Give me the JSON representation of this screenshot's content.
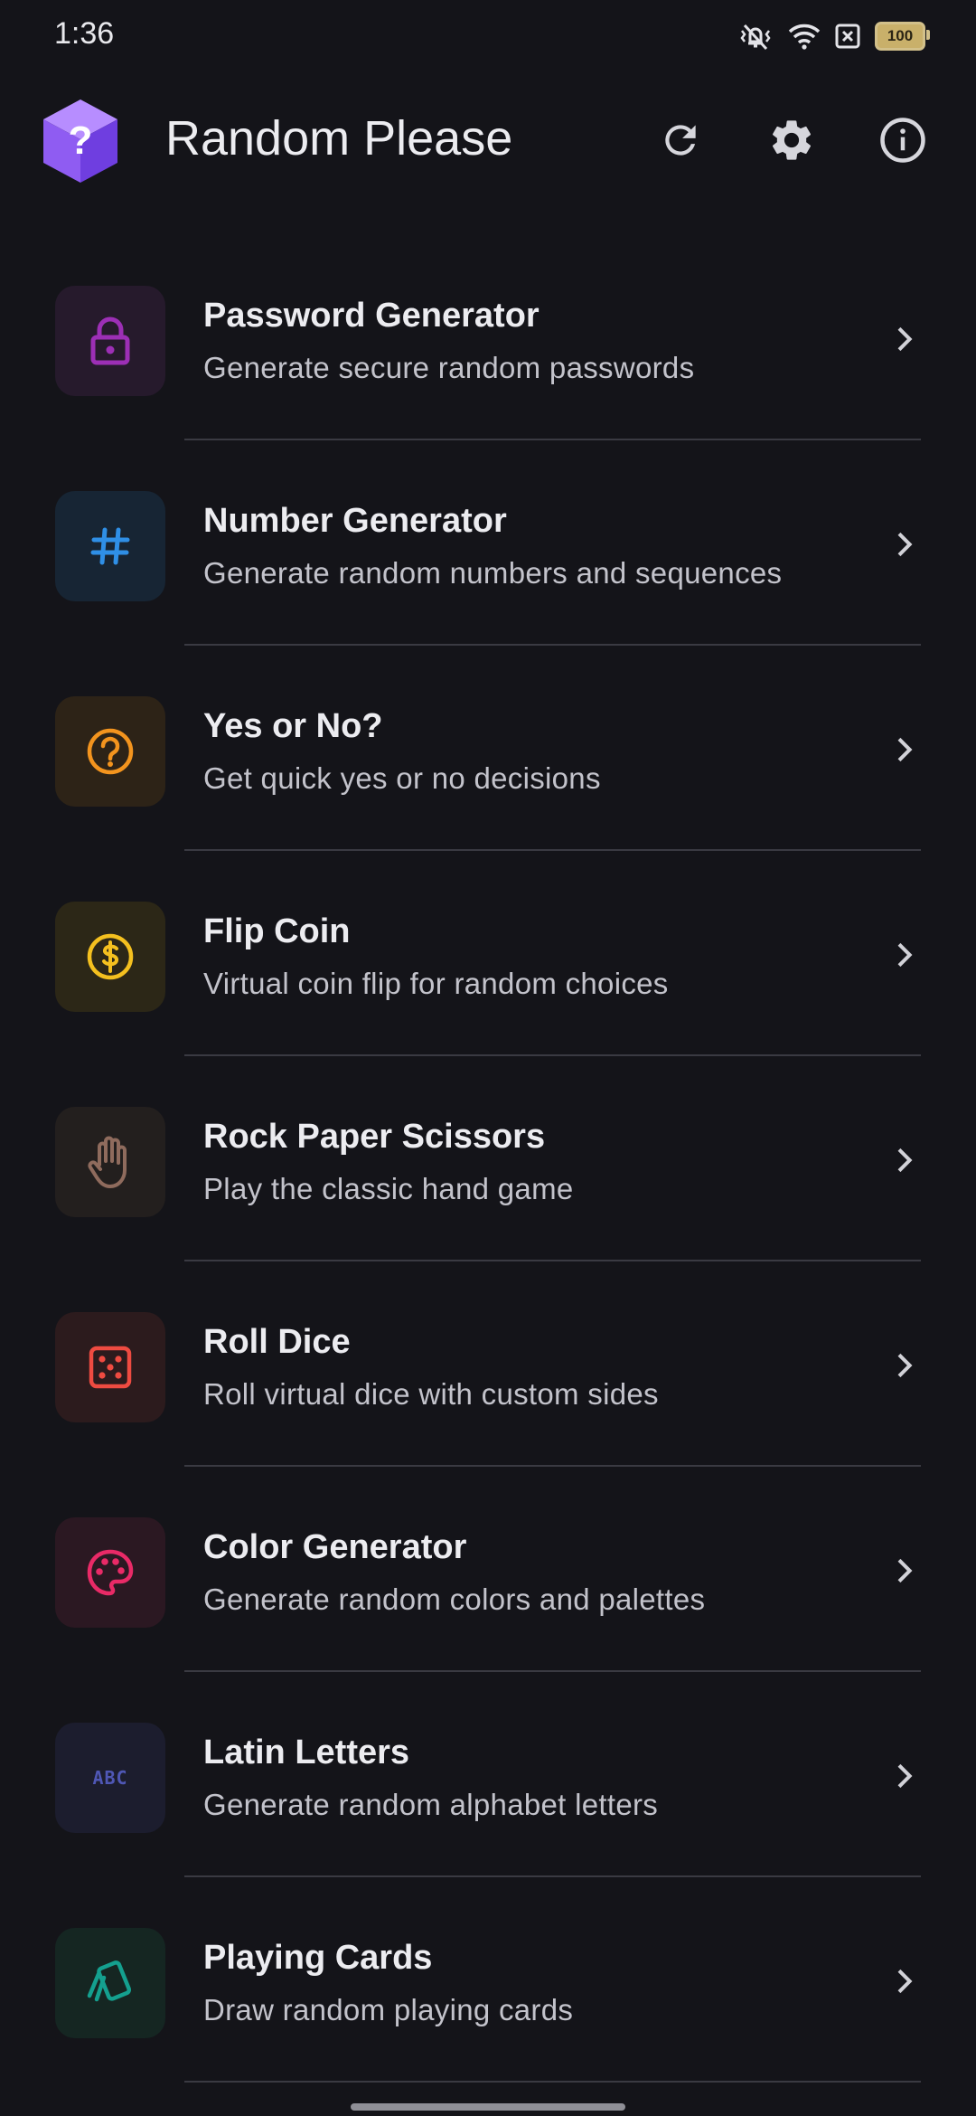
{
  "status_bar": {
    "time": "1:36",
    "battery": "100"
  },
  "app_bar": {
    "title": "Random Please",
    "logo_glyph": "?"
  },
  "items": [
    {
      "title": "Password Generator",
      "subtitle": "Generate secure random passwords",
      "icon": "lock-icon",
      "color": "#9c2fb5",
      "bg": "#261a2c"
    },
    {
      "title": "Number Generator",
      "subtitle": "Generate random numbers and sequences",
      "icon": "hash-icon",
      "color": "#2f8fe6",
      "bg": "#172534"
    },
    {
      "title": "Yes or No?",
      "subtitle": "Get quick yes or no decisions",
      "icon": "question-circle-icon",
      "color": "#f3941e",
      "bg": "#2d2317"
    },
    {
      "title": "Flip Coin",
      "subtitle": "Virtual coin flip for random choices",
      "icon": "coin-icon",
      "color": "#f4c01f",
      "bg": "#2c2717"
    },
    {
      "title": "Rock Paper Scissors",
      "subtitle": "Play the classic hand game",
      "icon": "hand-icon",
      "color": "#8f6b5d",
      "bg": "#231f1e"
    },
    {
      "title": "Roll Dice",
      "subtitle": "Roll virtual dice with custom sides",
      "icon": "dice-icon",
      "color": "#ee4b41",
      "bg": "#2c1b1d"
    },
    {
      "title": "Color Generator",
      "subtitle": "Generate random colors and palettes",
      "icon": "palette-icon",
      "color": "#e92a67",
      "bg": "#2b1822"
    },
    {
      "title": "Latin Letters",
      "subtitle": "Generate random alphabet letters",
      "icon": "abc-icon",
      "color": "#4f57b5",
      "bg": "#1c1d2e",
      "label": "ABC"
    },
    {
      "title": "Playing Cards",
      "subtitle": "Draw random playing cards",
      "icon": "cards-icon",
      "color": "#14a08f",
      "bg": "#152622"
    }
  ]
}
